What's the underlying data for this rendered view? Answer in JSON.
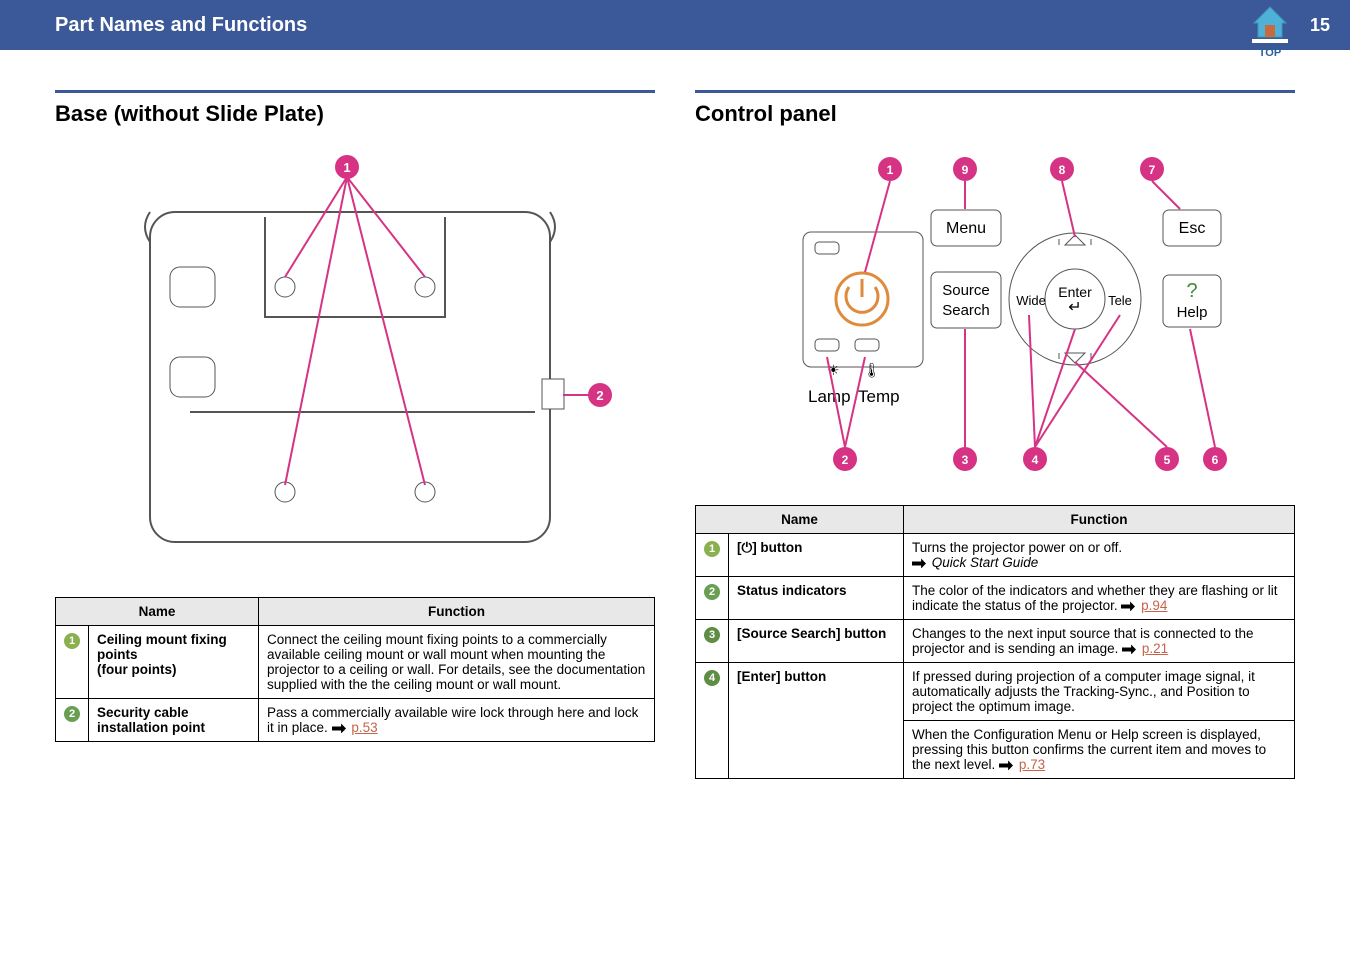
{
  "header": {
    "title": "Part Names and Functions",
    "page_number": "15",
    "top_label": "TOP"
  },
  "left": {
    "section_title": "Base (without Slide Plate)",
    "table": {
      "headers": {
        "name": "Name",
        "function": "Function"
      },
      "rows": [
        {
          "num": "1",
          "badge_class": "c1",
          "name": "Ceiling mount fixing points\n(four points)",
          "function": "Connect the ceiling mount fixing points to a commercially available ceiling mount or wall mount when mounting the projector to a ceiling or wall. For details, see the documentation supplied with the the ceiling mount or wall mount."
        },
        {
          "num": "2",
          "badge_class": "c2",
          "name": "Security cable installation point",
          "function_prefix": "Pass a commercially available wire lock through here and lock it in place. ",
          "ref": "p.53"
        }
      ]
    },
    "callouts": {
      "a": "1",
      "b": "2"
    }
  },
  "right": {
    "section_title": "Control panel",
    "diagram_labels": {
      "menu": "Menu",
      "esc": "Esc",
      "source": "Source\nSearch",
      "wide": "Wide",
      "enter": "Enter",
      "tele": "Tele",
      "help": "Help",
      "lamp": "Lamp",
      "temp": "Temp",
      "help_q": "?"
    },
    "callouts": {
      "1": "1",
      "2": "2",
      "3": "3",
      "4": "4",
      "5": "5",
      "6": "6",
      "7": "7",
      "8": "8",
      "9": "9"
    },
    "table": {
      "headers": {
        "name": "Name",
        "function": "Function"
      },
      "rows": [
        {
          "num": "1",
          "badge_class": "c1",
          "name_html": "[⏻] button",
          "function": "Turns the projector power on or off.",
          "ref_italic": "Quick Start Guide"
        },
        {
          "num": "2",
          "badge_class": "c2",
          "name": "Status indicators",
          "function_prefix": "The color of the indicators and whether they are flashing or lit indicate the status of the projector. ",
          "ref": "p.94"
        },
        {
          "num": "3",
          "badge_class": "c3",
          "name": "[Source Search] button",
          "function_prefix": "Changes to the next input source that is connected to the projector and is sending an image. ",
          "ref": "p.21"
        },
        {
          "num": "4",
          "badge_class": "c4",
          "name": "[Enter] button",
          "function_p1": "If pressed during projection of a computer image signal, it automatically adjusts the Tracking-Sync., and Position to project the optimum image.",
          "function_p2_prefix": "When the Configuration Menu or Help screen is displayed, pressing this button confirms the current item and moves to the next level. ",
          "ref": "p.73"
        }
      ]
    }
  }
}
